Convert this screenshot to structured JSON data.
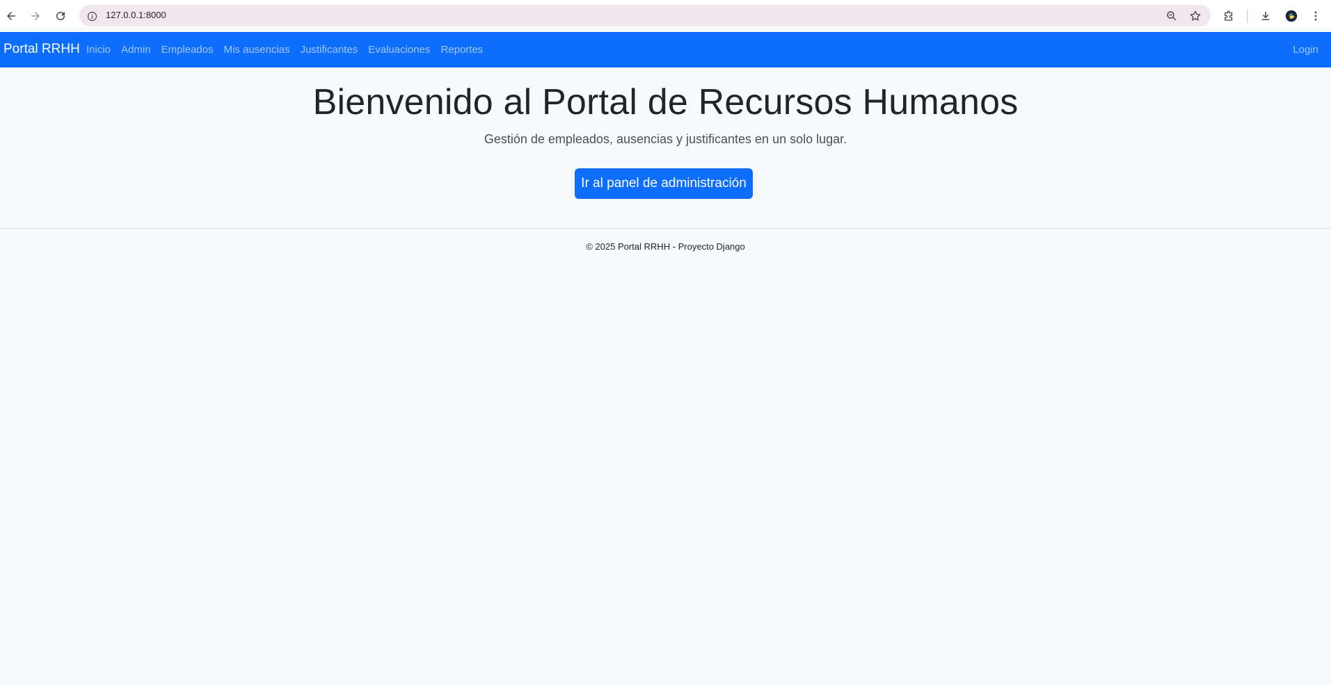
{
  "browser": {
    "url": "127.0.0.1:8000",
    "icons": [
      "back-icon",
      "forward-icon",
      "reload-icon",
      "site-info-icon",
      "zoom-icon",
      "star-icon",
      "extensions-icon",
      "download-icon",
      "profile-icon",
      "menu-icon"
    ]
  },
  "navbar": {
    "brand": "Portal RRHH",
    "links": [
      "Inicio",
      "Admin",
      "Empleados",
      "Mis ausencias",
      "Justificantes",
      "Evaluaciones",
      "Reportes"
    ],
    "login": "Login",
    "color": "#0d6efd"
  },
  "main": {
    "title": "Bienvenido al Portal de Recursos Humanos",
    "subtitle": "Gestión de empleados, ausencias y justificantes en un solo lugar.",
    "cta_label": "Ir al panel de administración"
  },
  "footer": {
    "text": "© 2025 Portal RRHH - Proyecto Django"
  }
}
